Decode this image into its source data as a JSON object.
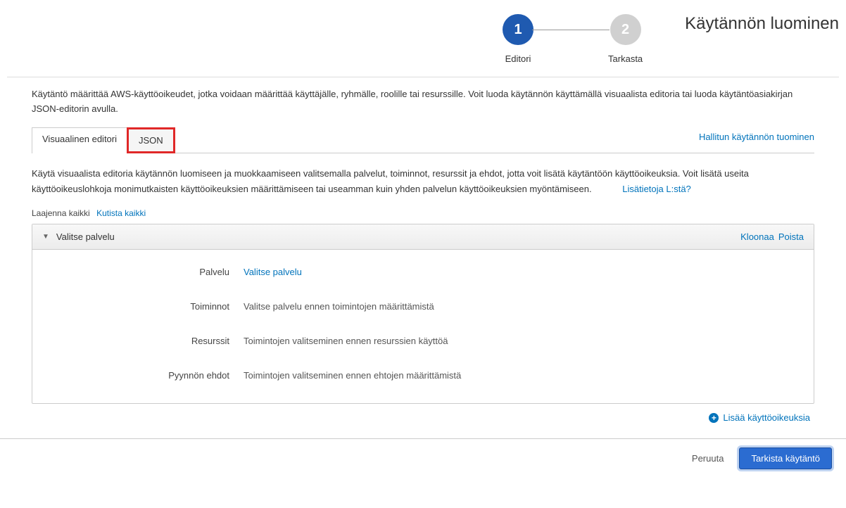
{
  "page_title": "Käytännön luominen",
  "wizard": {
    "step1_num": "1",
    "step1_label": "Editori",
    "step2_num": "2",
    "step2_label": "Tarkasta"
  },
  "description": "Käytäntö määrittää AWS-käyttöoikeudet, jotka voidaan määrittää käyttäjälle, ryhmälle, roolille tai resurssille. Voit luoda käytännön käyttämällä visuaalista editoria tai luoda käytäntöasiakirjan JSON-editorin avulla.",
  "tabs": {
    "visual": "Visuaalinen editori",
    "json": "JSON"
  },
  "import_link": "Hallitun käytännön tuominen",
  "visual_help": "Käytä visuaalista editoria käytännön luomiseen ja muokkaamiseen valitsemalla palvelut, toiminnot, resurssit ja ehdot, jotta voit lisätä käytäntöön käyttöoikeuksia. Voit lisätä useita käyttöoikeuslohkoja monimutkaisten käyttöoikeuksien määrittämiseen tai useamman kuin yhden palvelun käyttöoikeuksien myöntämiseen.",
  "learn_more": "Lisätietoja L:stä?",
  "expand_all": "Laajenna kaikki",
  "collapse_all": "Kutista kaikki",
  "panel": {
    "title": "Valitse palvelu",
    "clone": "Kloonaa",
    "remove": "Poista",
    "rows": {
      "service_label": "Palvelu",
      "service_value": "Valitse palvelu",
      "actions_label": "Toiminnot",
      "actions_value": "Valitse palvelu ennen toimintojen määrittämistä",
      "resources_label": "Resurssit",
      "resources_value": "Toimintojen valitseminen ennen resurssien käyttöä",
      "conditions_label": "Pyynnön ehdot",
      "conditions_value": "Toimintojen valitseminen ennen ehtojen määrittämistä"
    }
  },
  "add_permissions": "Lisää käyttöoikeuksia",
  "footer": {
    "cancel": "Peruuta",
    "review": "Tarkista käytäntö"
  }
}
